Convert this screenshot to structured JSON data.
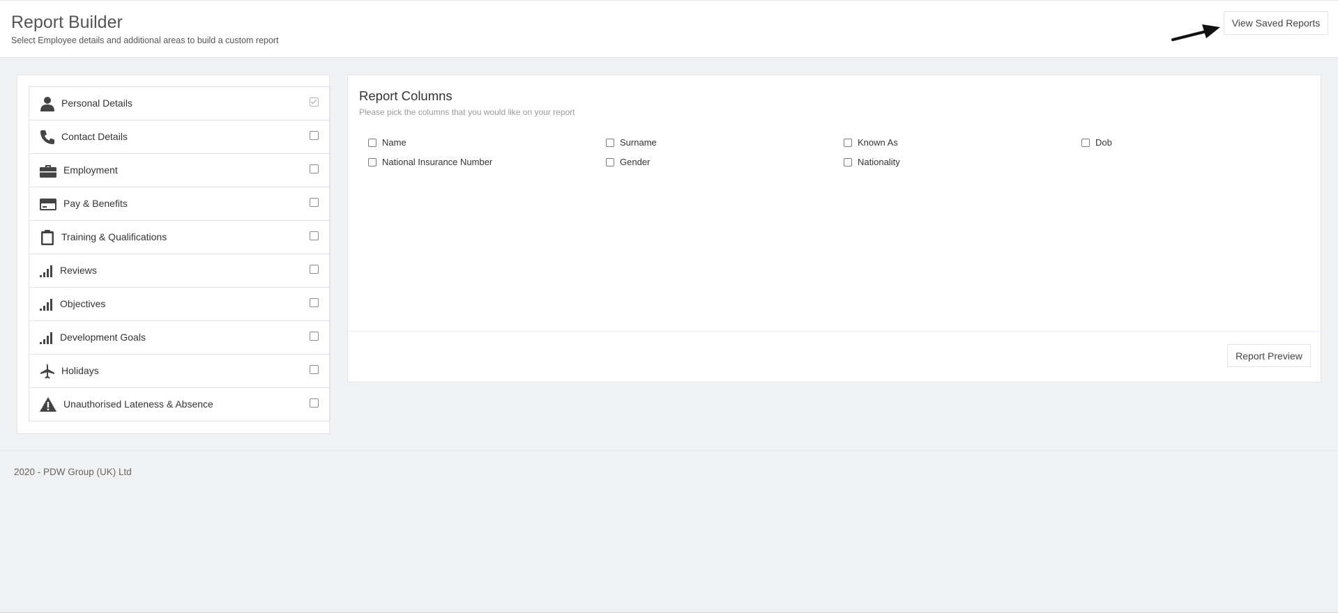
{
  "header": {
    "title": "Report Builder",
    "subtitle": "Select Employee details and additional areas to build a custom report",
    "view_saved_label": "View Saved Reports"
  },
  "sidebar": {
    "items": [
      {
        "label": "Personal Details",
        "icon": "person-icon",
        "checked": true
      },
      {
        "label": "Contact Details",
        "icon": "phone-icon",
        "checked": false
      },
      {
        "label": "Employment",
        "icon": "briefcase-icon",
        "checked": false
      },
      {
        "label": "Pay & Benefits",
        "icon": "credit-card-icon",
        "checked": false
      },
      {
        "label": "Training & Qualifications",
        "icon": "clipboard-icon",
        "checked": false
      },
      {
        "label": "Reviews",
        "icon": "signal-bars-icon",
        "checked": false
      },
      {
        "label": "Objectives",
        "icon": "signal-bars-icon",
        "checked": false
      },
      {
        "label": "Development Goals",
        "icon": "signal-bars-icon",
        "checked": false
      },
      {
        "label": "Holidays",
        "icon": "airplane-icon",
        "checked": false
      },
      {
        "label": "Unauthorised Lateness & Absence",
        "icon": "warning-icon",
        "checked": false
      }
    ]
  },
  "columns": {
    "title": "Report Columns",
    "subtitle": "Please pick the columns that you would like on your report",
    "options": [
      {
        "label": "Name",
        "checked": false
      },
      {
        "label": "Surname",
        "checked": false
      },
      {
        "label": "Known As",
        "checked": false
      },
      {
        "label": "Dob",
        "checked": false
      },
      {
        "label": "National Insurance Number",
        "checked": false
      },
      {
        "label": "Gender",
        "checked": false
      },
      {
        "label": "Nationality",
        "checked": false
      }
    ],
    "preview_label": "Report Preview"
  },
  "footer": {
    "text": "2020 - PDW Group (UK) Ltd"
  },
  "colors": {
    "background": "#f0f1f3",
    "icon": "#444444"
  }
}
